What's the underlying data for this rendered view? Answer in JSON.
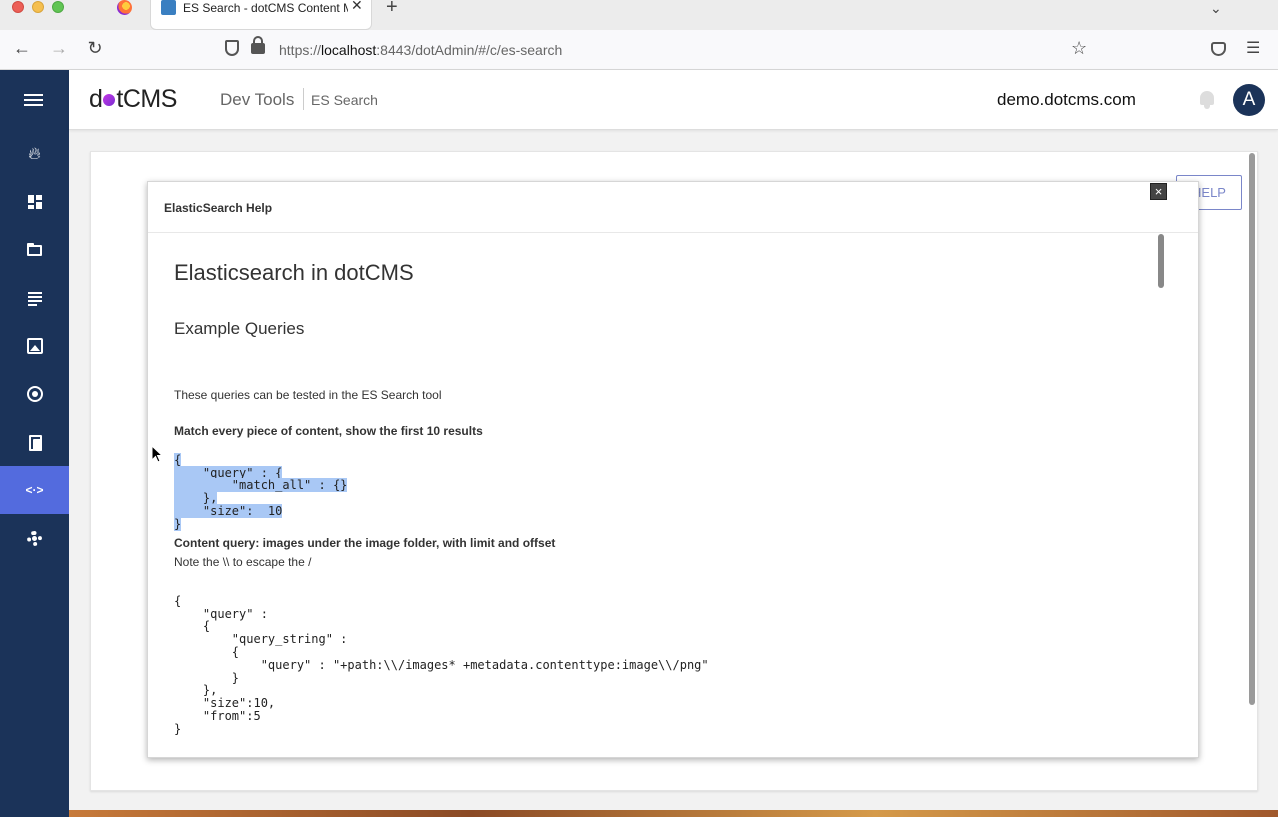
{
  "browser": {
    "tab_title": "ES Search - dotCMS Content Management",
    "url_prefix": "https://",
    "url_host": "localhost",
    "url_rest": ":8443/dotAdmin/#/c/es-search"
  },
  "topbar": {
    "logo_left": "d",
    "logo_right": "tCMS",
    "crumb_section": "Dev Tools",
    "crumb_page": "ES Search",
    "site": "demo.dotcms.com",
    "avatar_initial": "A"
  },
  "sidebar": {
    "icons": [
      "menu-icon",
      "fire-icon",
      "dashboard-icon",
      "folder-icon",
      "content-icon",
      "image-icon",
      "target-icon",
      "files-icon",
      "dev-tools-icon",
      "gear-icon"
    ],
    "active": "dev-tools-icon",
    "active_color": "#536bde",
    "bg_color": "#1b3359"
  },
  "help_button": "HELP",
  "dialog": {
    "title": "ElasticSearch Help",
    "heading": "Elasticsearch in dotCMS",
    "subheading": "Example Queries",
    "intro": "These queries can be tested in the ES Search tool",
    "example1_title": "Match every piece of content, show the first 10 results",
    "example1_code": [
      "{",
      "    \"query\" : {",
      "        \"match_all\" : {}",
      "    },",
      "    \"size\":  10",
      "}"
    ],
    "example2_title": "Content query: images under the image folder, with limit and offset",
    "example2_note": "Note the \\\\ to escape the /",
    "example2_code": [
      "{",
      "    \"query\" :",
      "    {",
      "        \"query_string\" :",
      "        {",
      "            \"query\" : \"+path:\\\\/images* +metadata.contenttype:image\\\\/png\"",
      "        }",
      "    },",
      "    \"size\":10,",
      "    \"from\":5",
      "}"
    ],
    "close": "×"
  }
}
